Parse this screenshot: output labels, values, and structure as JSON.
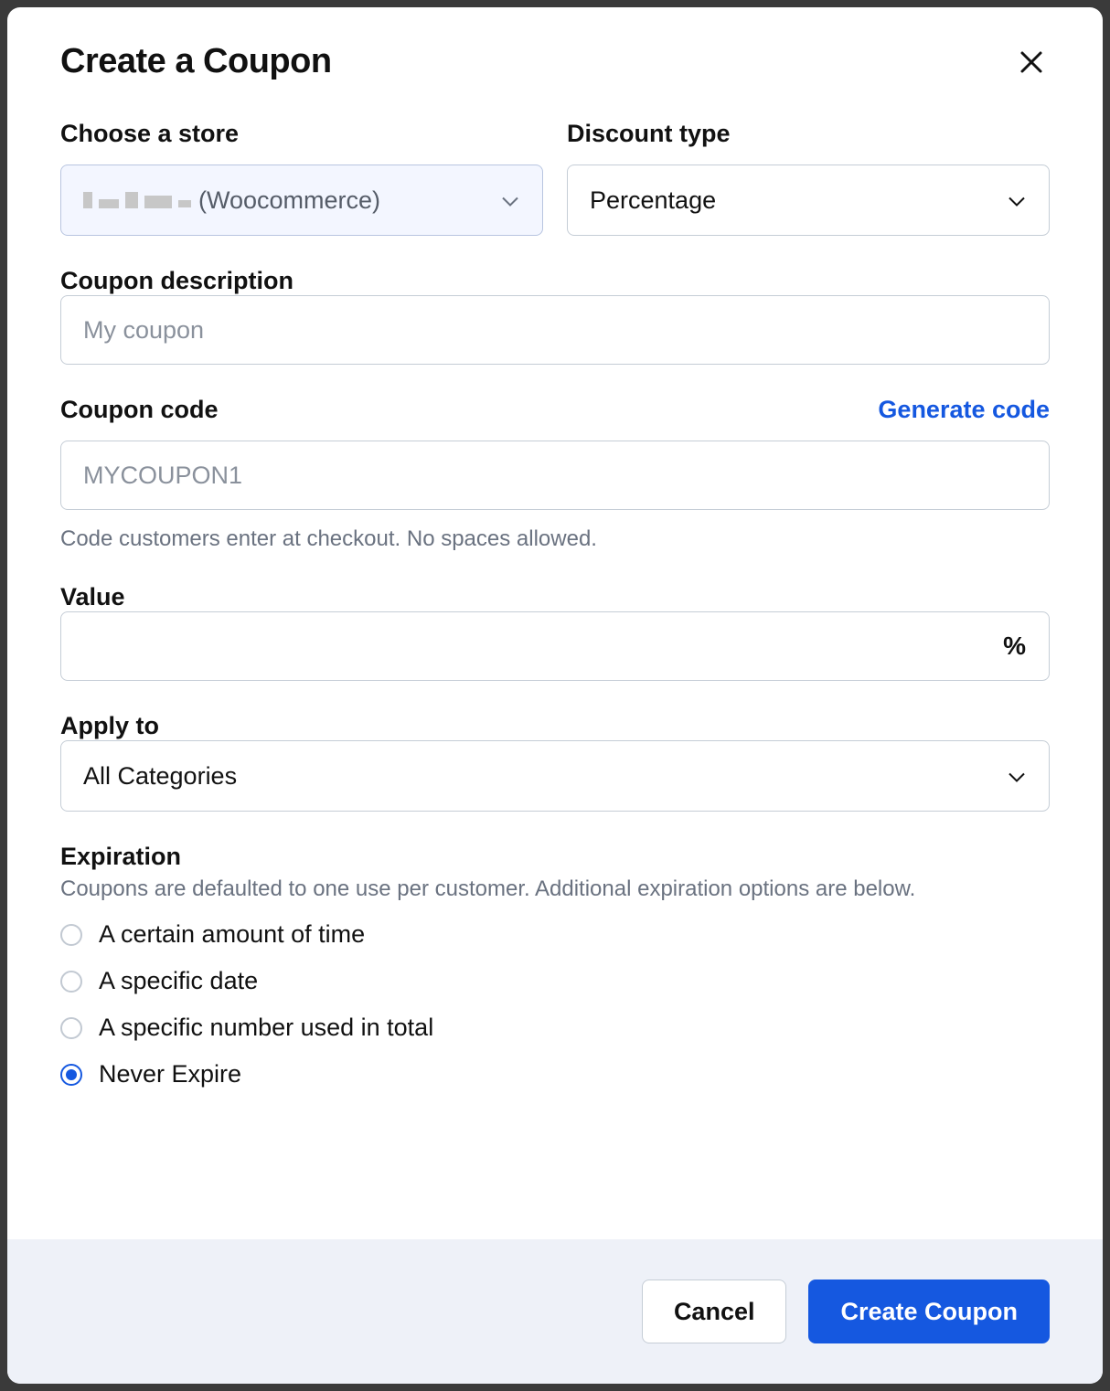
{
  "modal": {
    "title": "Create a Coupon"
  },
  "store": {
    "label": "Choose a store",
    "value_suffix": "(Woocommerce)"
  },
  "discount_type": {
    "label": "Discount type",
    "value": "Percentage"
  },
  "description": {
    "label": "Coupon description",
    "placeholder": "My coupon",
    "value": ""
  },
  "code": {
    "label": "Coupon code",
    "generate_link": "Generate code",
    "placeholder": "MYCOUPON1",
    "value": "",
    "helper": "Code customers enter at checkout. No spaces allowed."
  },
  "value_field": {
    "label": "Value",
    "value": "",
    "suffix": "%"
  },
  "apply_to": {
    "label": "Apply to",
    "value": "All Categories"
  },
  "expiration": {
    "label": "Expiration",
    "helper": "Coupons are defaulted to one use per customer. Additional expiration options are below.",
    "options": [
      {
        "label": "A certain amount of time",
        "selected": false
      },
      {
        "label": "A specific date",
        "selected": false
      },
      {
        "label": "A specific number used in total",
        "selected": false
      },
      {
        "label": "Never Expire",
        "selected": true
      }
    ]
  },
  "footer": {
    "cancel": "Cancel",
    "submit": "Create Coupon"
  }
}
